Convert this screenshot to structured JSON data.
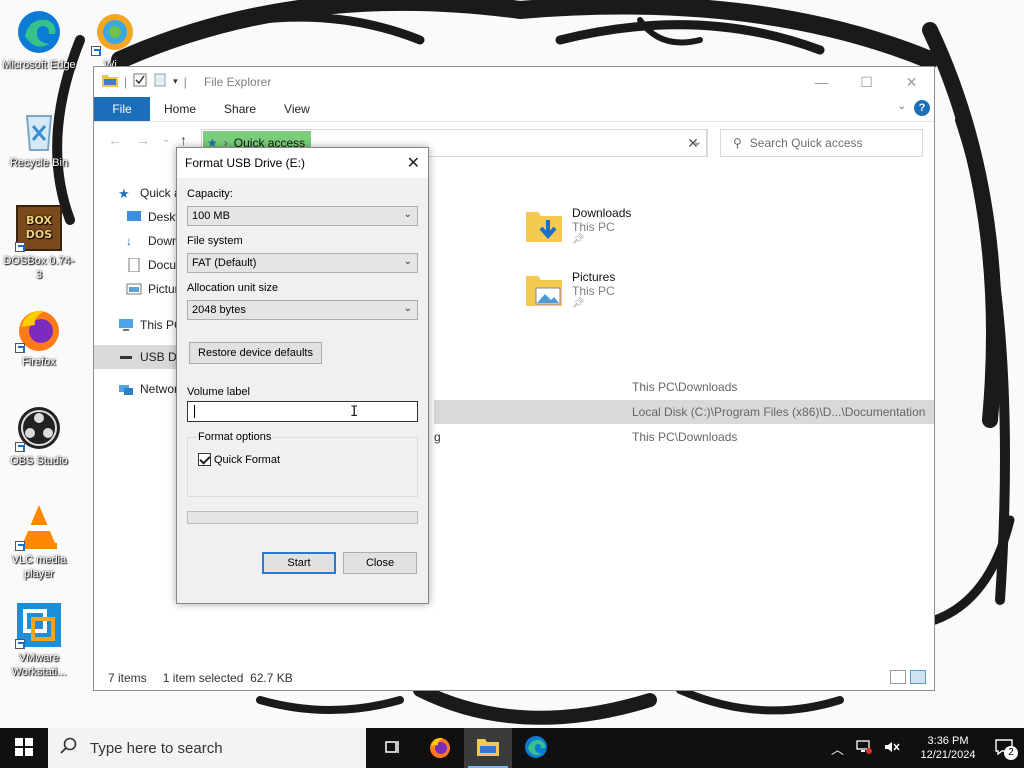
{
  "desktop": {
    "icons": [
      {
        "label": "Microsoft Edge",
        "icon": "edge-icon"
      },
      {
        "label": "Wi...",
        "icon": "waterfox-icon"
      },
      {
        "label": "Recycle Bin",
        "icon": "recycle-bin-icon"
      },
      {
        "label": "DOSBox 0.74-3",
        "icon": "dosbox-icon"
      },
      {
        "label": "Firefox",
        "icon": "firefox-icon"
      },
      {
        "label": "OBS Studio",
        "icon": "obs-icon"
      },
      {
        "label": "VLC media player",
        "icon": "vlc-icon"
      },
      {
        "label": "VMware Workstati...",
        "icon": "vmware-icon"
      }
    ]
  },
  "explorer": {
    "title": "File Explorer",
    "ribbon_tabs": [
      "File",
      "Home",
      "Share",
      "View"
    ],
    "address_crumb": "Quick access",
    "search_placeholder": "Search Quick access",
    "nav_items": [
      {
        "label": "Quick access",
        "icon": "star-icon"
      },
      {
        "label": "Desktop",
        "icon": "desktop-icon"
      },
      {
        "label": "Downloads",
        "icon": "download-icon"
      },
      {
        "label": "Documents",
        "icon": "documents-icon"
      },
      {
        "label": "Pictures",
        "icon": "pictures-icon"
      },
      {
        "label": "This PC",
        "icon": "computer-icon"
      },
      {
        "label": "USB Drive (E:)",
        "icon": "usb-drive-icon"
      },
      {
        "label": "Network",
        "icon": "network-icon"
      }
    ],
    "folders": [
      {
        "name": "Downloads",
        "location": "This PC"
      },
      {
        "name": "Pictures",
        "location": "This PC"
      }
    ],
    "recent": [
      {
        "fragment": "",
        "location": "This PC\\Downloads"
      },
      {
        "fragment": "",
        "location": "Local Disk (C:)\\Program Files (x86)\\D...\\Documentation"
      },
      {
        "fragment": "g",
        "location": "This PC\\Downloads"
      }
    ],
    "status": {
      "items": "7 items",
      "selected": "1 item selected  62.7 KB"
    }
  },
  "format_dialog": {
    "title": "Format USB Drive (E:)",
    "capacity_label": "Capacity:",
    "capacity_value": "100 MB",
    "filesystem_label": "File system",
    "filesystem_value": "FAT (Default)",
    "allocation_label": "Allocation unit size",
    "allocation_value": "2048 bytes",
    "restore_button": "Restore device defaults",
    "volume_label": "Volume label",
    "volume_value": "",
    "format_options_label": "Format options",
    "quick_format_label": "Quick Format",
    "quick_format_checked": true,
    "progress": 0,
    "start_button": "Start",
    "close_button": "Close"
  },
  "taskbar": {
    "search_placeholder": "Type here to search",
    "time": "3:36 PM",
    "date": "12/21/2024",
    "notification_count": "2"
  }
}
